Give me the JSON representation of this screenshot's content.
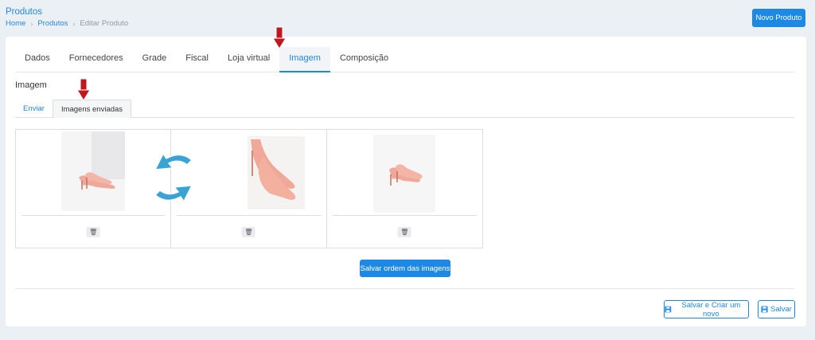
{
  "header": {
    "title": "Produtos",
    "breadcrumb": [
      "Home",
      "Produtos",
      "Editar Produto"
    ],
    "new_button": "Novo Produto"
  },
  "tabs": [
    "Dados",
    "Fornecedores",
    "Grade",
    "Fiscal",
    "Loja virtual",
    "Imagem",
    "Composição"
  ],
  "active_tab": "Imagem",
  "section_label": "Imagem",
  "subtabs": [
    "Enviar",
    "Imagens enviadas"
  ],
  "active_subtab": "Imagens enviadas",
  "gallery": {
    "items": [
      {
        "icon": "trash-icon"
      },
      {
        "icon": "trash-icon"
      },
      {
        "icon": "trash-icon"
      }
    ]
  },
  "save_order_button": "Salvar ordem das imagens",
  "footer": {
    "save_new_button": "Salvar e Criar um novo",
    "save_button": "Salvar"
  },
  "colors": {
    "accent": "#1e88e5",
    "background": "#ebf0f5",
    "shoe": "#f0a898",
    "swap_arrow": "#3aa3d6",
    "annotation_arrow": "#c0181e"
  }
}
